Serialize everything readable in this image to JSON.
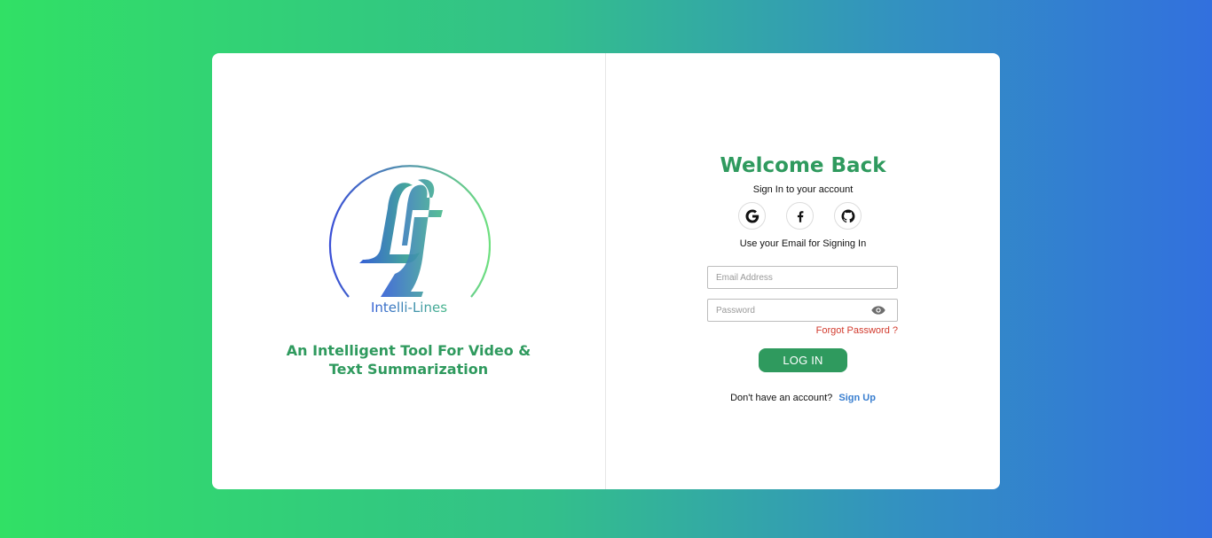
{
  "brand": {
    "logo_text": "Intelli-Lines",
    "tagline_line1": "An Intelligent Tool For Video &",
    "tagline_line2": "Text Summarization"
  },
  "login": {
    "title": "Welcome Back",
    "subtitle": "Sign In to your account",
    "social": [
      {
        "icon": "google-icon"
      },
      {
        "icon": "facebook-icon"
      },
      {
        "icon": "github-icon"
      }
    ],
    "email_hint": "Use your Email for Signing In",
    "email_placeholder": "Email Address",
    "email_value": "",
    "password_placeholder": "Password",
    "password_value": "",
    "forgot_label": "Forgot Password ?",
    "submit_label": "LOG IN",
    "signup_prompt": "Don't have an account?",
    "signup_label": "Sign Up"
  },
  "colors": {
    "accent_green": "#2f9a5e",
    "link_blue": "#3a7fd0",
    "forgot_red": "#d23b2e",
    "bg_gradient_start": "#31e065",
    "bg_gradient_end": "#3270de"
  }
}
